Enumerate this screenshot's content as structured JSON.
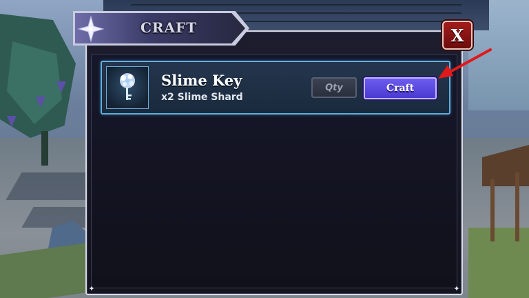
{
  "window": {
    "title": "CRAFT",
    "close_label": "X"
  },
  "recipes": [
    {
      "name": "Slime Key",
      "requirement": "x2 Slime Shard",
      "icon": "slime-key-icon",
      "qty_label": "Qty",
      "craft_label": "Craft"
    }
  ],
  "colors": {
    "panel_bg": "#16172a",
    "row_border": "#5fb0e0",
    "craft_button": "#5b4ae0",
    "close_button": "#a31c1c",
    "annotation_arrow": "#e01a1a"
  }
}
